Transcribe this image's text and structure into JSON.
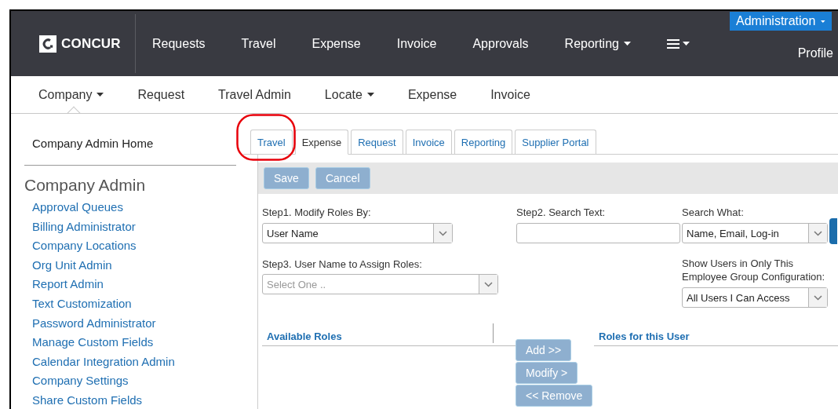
{
  "top_nav": {
    "logo": "CONCUR",
    "items": [
      {
        "label": "Requests",
        "dropdown": false
      },
      {
        "label": "Travel",
        "dropdown": false
      },
      {
        "label": "Expense",
        "dropdown": false
      },
      {
        "label": "Invoice",
        "dropdown": false
      },
      {
        "label": "Approvals",
        "dropdown": false
      },
      {
        "label": "Reporting",
        "dropdown": true
      }
    ],
    "admin_button": "Administration",
    "profile": "Profile"
  },
  "sub_nav": {
    "items": [
      {
        "label": "Company",
        "dropdown": true,
        "selected": true
      },
      {
        "label": "Request",
        "dropdown": false,
        "selected": false
      },
      {
        "label": "Travel Admin",
        "dropdown": false,
        "selected": false
      },
      {
        "label": "Locate",
        "dropdown": true,
        "selected": false
      },
      {
        "label": "Expense",
        "dropdown": false,
        "selected": false
      },
      {
        "label": "Invoice",
        "dropdown": false,
        "selected": false
      }
    ]
  },
  "sidebar": {
    "home": "Company Admin Home",
    "heading": "Company Admin",
    "links": [
      "Approval Queues",
      "Billing Administrator",
      "Company Locations",
      "Org Unit Admin",
      "Report Admin",
      "Text Customization",
      "Password Administrator",
      "Manage Custom Fields",
      "Calendar Integration Admin",
      "Company Settings",
      "Share Custom Fields"
    ]
  },
  "tabs": [
    {
      "label": "Travel",
      "selected": false
    },
    {
      "label": "Expense",
      "selected": true
    },
    {
      "label": "Request",
      "selected": false
    },
    {
      "label": "Invoice",
      "selected": false
    },
    {
      "label": "Reporting",
      "selected": false
    },
    {
      "label": "Supplier Portal",
      "selected": false
    }
  ],
  "toolbar": {
    "buttons": [
      {
        "label": "Save",
        "disabled": true
      },
      {
        "label": "Cancel",
        "disabled": true
      }
    ]
  },
  "form": {
    "step1": {
      "label": "Step1. Modify Roles By:",
      "value": "User Name"
    },
    "step2": {
      "label": "Step2. Search Text:"
    },
    "search_what": {
      "label": "Search What:",
      "value": "Name, Email, Log-in"
    },
    "step3": {
      "label": "Step3. User Name to Assign Roles:",
      "placeholder": "Select One ..",
      "disabled": true
    },
    "group": {
      "label": "Show Users in Only This Employee Group Configuration:",
      "value": "All Users I Can Access"
    }
  },
  "roles": {
    "available_title": "Available Roles",
    "assigned_title": "Roles for this User",
    "buttons": [
      {
        "label": "Add >>",
        "disabled": true
      },
      {
        "label": "Modify >",
        "disabled": true
      },
      {
        "label": "<< Remove",
        "disabled": true
      }
    ]
  }
}
